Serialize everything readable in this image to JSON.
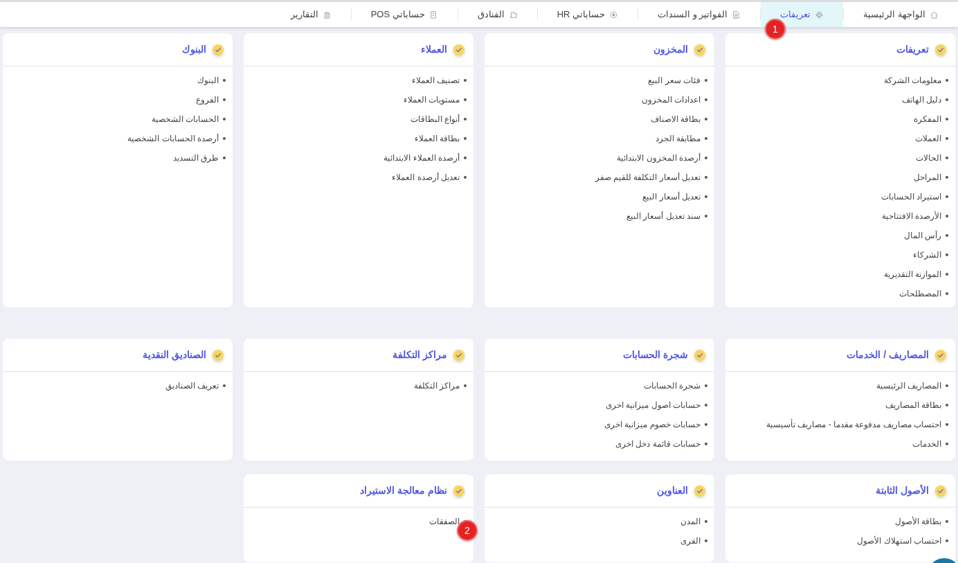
{
  "tabs": [
    {
      "label": "الواجهة الرئيسية",
      "selected": false
    },
    {
      "label": "تعريفات",
      "selected": true
    },
    {
      "label": "الفواتير و السندات",
      "selected": false
    },
    {
      "label": "حساباتي HR",
      "selected": false
    },
    {
      "label": "الفنادق",
      "selected": false
    },
    {
      "label": "حساباتي POS",
      "selected": false
    },
    {
      "label": "التقارير",
      "selected": false
    }
  ],
  "card_rows": [
    [
      {
        "title": "تعريفات",
        "items": [
          "معلومات الشركة",
          "دليل الهاتف",
          "المفكرة",
          "العملات",
          "الحالات",
          "المراحل",
          "استيراد الحسابات",
          "الأرصدة الافتتاحية",
          "رأس المال",
          "الشركاء",
          "الموازنة التقديرية",
          "المصطلحات"
        ]
      },
      {
        "title": "المخزون",
        "items": [
          "فئات سعر البيع",
          "اعدادات المخزون",
          "بطاقة الاصناف",
          "مطابقة الجرد",
          "أرصدة المخزون الابتدائية",
          "تعديل أسعار التكلفة للقيم صفر",
          "تعديل أسعار البيع",
          "سند تعديل أسعار البيع"
        ]
      },
      {
        "title": "العملاء",
        "items": [
          "تصنيف العملاء",
          "مستويات العملاء",
          "أنواع البطاقات",
          "بطاقة العملاء",
          "أرصدة العملاء الابتدائية",
          "تعديل أرصدة العملاء"
        ]
      },
      {
        "title": "البنوك",
        "items": [
          "البنوك",
          "الفروع",
          "الحسابات الشخصية",
          "أرصدة الحسابات الشخصية",
          "طرق التسديد"
        ]
      }
    ],
    [
      {
        "title": "المصاريف / الخدمات",
        "items": [
          "المصاريف الرئيسية",
          "بطاقة المصاريف",
          "احتساب مصاريف مدفوعة مقدما - مصاريف تأسيسية",
          "الخدمات"
        ]
      },
      {
        "title": "شجرة الحسابات",
        "items": [
          "شجرة الحسابات",
          "حسابات اصول ميزانية اخرى",
          "حسابات خصوم ميزانية اخرى",
          "حسابات قائمة دخل اخرى"
        ]
      },
      {
        "title": "مراكز التكلفة",
        "items": [
          "مراكز التكلفة"
        ]
      },
      {
        "title": "الصناديق النقدية",
        "items": [
          "تعريف الصناديق"
        ]
      }
    ],
    [
      {
        "title": "الأصول الثابتة",
        "items": [
          "بطاقة الأصول",
          "احتساب استهلاك الأصول"
        ]
      },
      {
        "title": "العناوين",
        "items": [
          "المدن",
          "القرى"
        ]
      },
      {
        "title": "نظام معالجة الاستيراد",
        "items": [
          "الصفقات"
        ]
      }
    ]
  ],
  "callouts": [
    {
      "text": "1"
    },
    {
      "text": "2"
    }
  ]
}
